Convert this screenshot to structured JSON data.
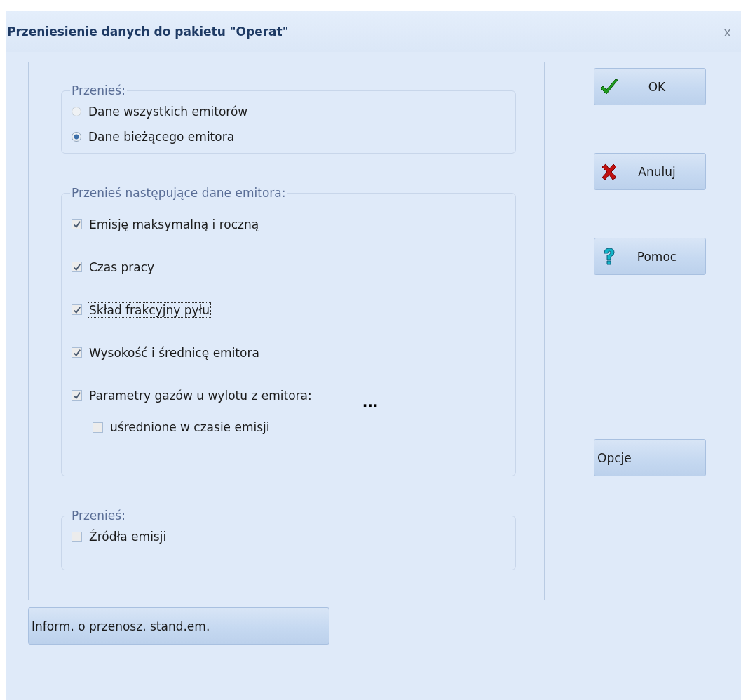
{
  "window": {
    "title": "Przeniesienie danych do pakietu \"Operat\"",
    "close": "x"
  },
  "scope_group": {
    "legend": "Przenieś:",
    "options": [
      {
        "label": "Dane wszystkich emitorów",
        "selected": false
      },
      {
        "label": "Dane bieżącego emitora",
        "selected": true
      }
    ]
  },
  "data_group": {
    "legend": "Przenieś następujące dane emitora:",
    "items": [
      {
        "label": "Emisję maksymalną i roczną",
        "checked": true,
        "focused": false
      },
      {
        "label": "Czas pracy",
        "checked": true,
        "focused": false
      },
      {
        "label": "Skład frakcyjny pyłu",
        "checked": true,
        "focused": true
      },
      {
        "label": "Wysokość i średnicę emitora",
        "checked": true,
        "focused": false
      },
      {
        "label": "Parametry gazów u wylotu z emitora:",
        "checked": true,
        "focused": false,
        "more": "...",
        "children": [
          {
            "label": "uśrednione w czasie emisji",
            "checked": false,
            "focused": false
          }
        ]
      }
    ]
  },
  "sources_group": {
    "legend": "Przenieś:",
    "items": [
      {
        "label": "Źródła emisji",
        "checked": false,
        "focused": false
      }
    ]
  },
  "buttons": [
    {
      "kind": "ok",
      "rest": "OK"
    },
    {
      "kind": "cancel",
      "underlined": "A",
      "rest": "nuluj"
    },
    {
      "kind": "help",
      "underlined": "P",
      "rest": "omoc"
    }
  ],
  "options_button": "Opcje",
  "info_button": "Inform. o przenosz. stand.em."
}
